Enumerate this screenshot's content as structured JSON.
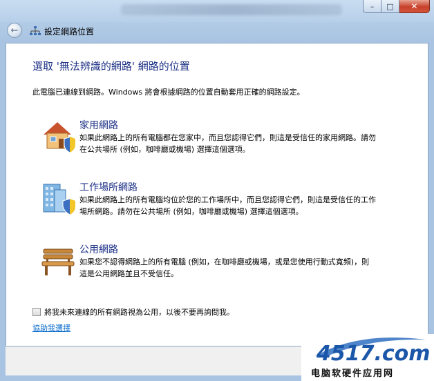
{
  "window": {
    "title": "設定網路位置",
    "controls": {
      "minimize": "–",
      "maximize": "□",
      "close": "✕"
    },
    "back_icon": "back-arrow-icon"
  },
  "main": {
    "heading": "選取 '無法辨識的網路' 網路的位置",
    "description": "此電腦已連線到網路。Windows 將會根據網路的位置自動套用正確的網路設定。",
    "options": [
      {
        "icon": "home-network-icon",
        "title": "家用網路",
        "description": "如果此網路上的所有電腦都在您家中，而且您認得它們，則這是受信任的家用網路。請勿在公共場所 (例如，咖啡廳或機場) 選擇這個選項。"
      },
      {
        "icon": "work-network-icon",
        "title": "工作場所網路",
        "description": "如果此網路上的所有電腦均位於您的工作場所中，而且您認得它們，則這是受信任的工作場所網路。請勿在公共場所 (例如，咖啡廳或機場) 選擇這個選項。"
      },
      {
        "icon": "public-network-icon",
        "title": "公用網路",
        "description": "如果您不認得網路上的所有電腦 (例如，在咖啡廳或機場，或是您使用行動式寬頻)，則這是公用網路並且不受信任。"
      }
    ],
    "checkbox_label": "將我未來連線的所有網路視為公用，以後不要再詢問我。",
    "checkbox_checked": false,
    "help_link": "協助我選擇"
  },
  "watermark": {
    "logo_text": "4517.com",
    "subtitle": "电脑软硬件应用网"
  },
  "colors": {
    "heading": "#1e3287",
    "link": "#0066cc",
    "frame": "#a9c4e2"
  }
}
